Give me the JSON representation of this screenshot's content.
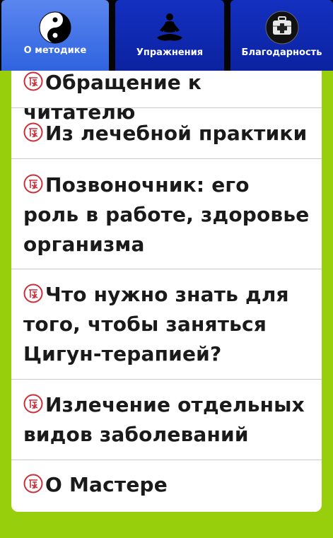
{
  "tabs": [
    {
      "label": "О методике",
      "icon": "yin-yang-icon",
      "active": true
    },
    {
      "label": "Упражнения",
      "icon": "meditation-icon",
      "active": false
    },
    {
      "label": "Благодарность",
      "icon": "first-aid-kit-icon",
      "active": false
    }
  ],
  "items": [
    {
      "label": "Обращение к читателю"
    },
    {
      "label": "Из лечебной практики"
    },
    {
      "label": "Позвоночник: его роль в работе, здоровье организма"
    },
    {
      "label": "Что нужно знать для того, чтобы заняться Цигун-терапией?"
    },
    {
      "label": "Излечение отдельных видов заболеваний"
    },
    {
      "label": "О Мастере"
    }
  ],
  "colors": {
    "background": "#97cf0c",
    "tab_active": "#4c7aea",
    "tab_inactive": "#1330c0",
    "item_icon": "#c8303a"
  }
}
